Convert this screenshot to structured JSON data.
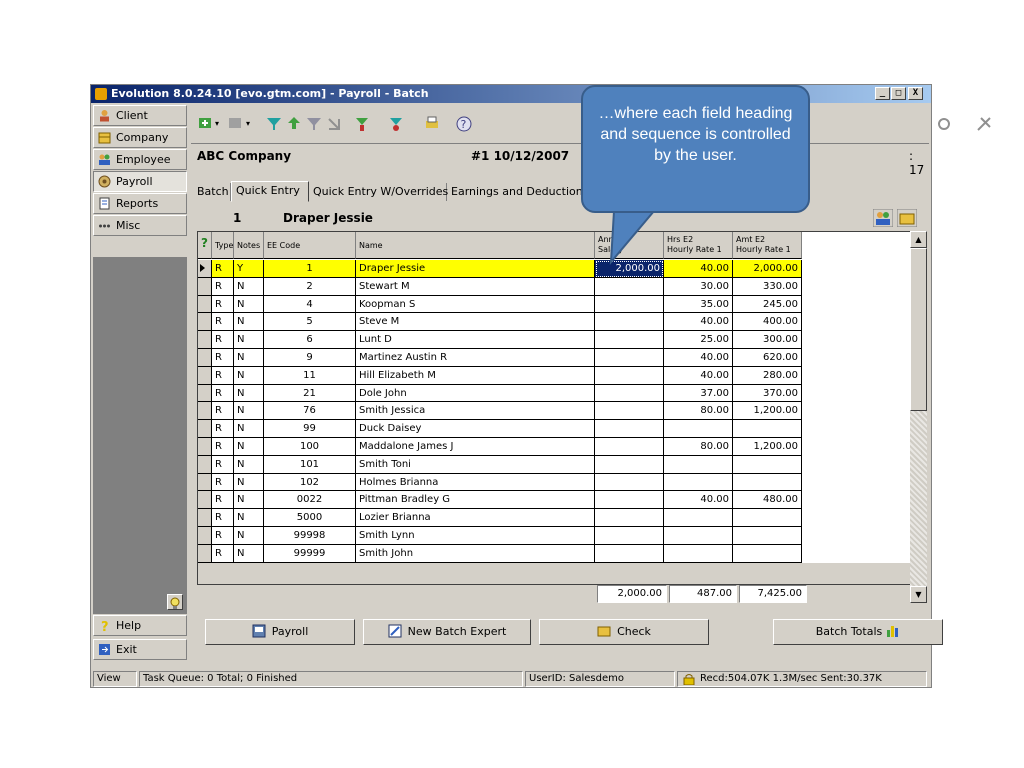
{
  "window": {
    "title": "Evolution 8.0.24.10 [evo.gtm.com] - Payroll - Batch",
    "controls": [
      "_",
      "□",
      "X"
    ]
  },
  "sidebar": {
    "items": [
      {
        "label": "Client",
        "icon": "person-icon"
      },
      {
        "label": "Company",
        "icon": "building-icon"
      },
      {
        "label": "Employee",
        "icon": "people-icon"
      },
      {
        "label": "Payroll",
        "icon": "payroll-icon",
        "active": true
      },
      {
        "label": "Reports",
        "icon": "report-icon"
      },
      {
        "label": "Misc",
        "icon": "dots-icon"
      }
    ],
    "help": "Help",
    "exit": "Exit"
  },
  "header": {
    "company": "ABC Company",
    "batch": "#1 10/12/2007",
    "right_value": ": 17"
  },
  "tabs": [
    "Batch",
    "Quick Entry",
    "Quick Entry W/Overrides",
    "Earnings and Deductions"
  ],
  "active_tab": "Quick Entry",
  "current_employee": {
    "code": "1",
    "name": "Draper Jessie"
  },
  "grid": {
    "columns": [
      "Type",
      "Notes",
      "EE Code",
      "Name",
      "Annual Salary",
      "Hrs E2 Hourly Rate 1",
      "Amt E2 Hourly Rate 1"
    ],
    "col_header_lines": [
      [
        "Type"
      ],
      [
        "Notes"
      ],
      [
        "EE Code"
      ],
      [
        "Name"
      ],
      [
        "Annual",
        "Salary"
      ],
      [
        "Hrs E2",
        "Hourly Rate 1"
      ],
      [
        "Amt E2",
        "Hourly Rate 1"
      ]
    ],
    "rows": [
      [
        "R",
        "Y",
        "1",
        "Draper Jessie",
        "2,000.00",
        "40.00",
        "2,000.00"
      ],
      [
        "R",
        "N",
        "2",
        "Stewart M",
        "",
        "30.00",
        "330.00"
      ],
      [
        "R",
        "N",
        "4",
        "Koopman S",
        "",
        "35.00",
        "245.00"
      ],
      [
        "R",
        "N",
        "5",
        "Steve M",
        "",
        "40.00",
        "400.00"
      ],
      [
        "R",
        "N",
        "6",
        "Lunt D",
        "",
        "25.00",
        "300.00"
      ],
      [
        "R",
        "N",
        "9",
        "Martinez Austin R",
        "",
        "40.00",
        "620.00"
      ],
      [
        "R",
        "N",
        "11",
        "Hill Elizabeth M",
        "",
        "40.00",
        "280.00"
      ],
      [
        "R",
        "N",
        "21",
        "Dole John",
        "",
        "37.00",
        "370.00"
      ],
      [
        "R",
        "N",
        "76",
        "Smith Jessica",
        "",
        "80.00",
        "1,200.00"
      ],
      [
        "R",
        "N",
        "99",
        "Duck Daisey",
        "",
        "",
        ""
      ],
      [
        "R",
        "N",
        "100",
        "Maddalone James J",
        "",
        "80.00",
        "1,200.00"
      ],
      [
        "R",
        "N",
        "101",
        "Smith Toni",
        "",
        "",
        ""
      ],
      [
        "R",
        "N",
        "102",
        "Holmes Brianna",
        "",
        "",
        ""
      ],
      [
        "R",
        "N",
        "0022",
        "Pittman Bradley G",
        "",
        "40.00",
        "480.00"
      ],
      [
        "R",
        "N",
        "5000",
        "Lozier Brianna",
        "",
        "",
        ""
      ],
      [
        "R",
        "N",
        "99998",
        "Smith Lynn",
        "",
        "",
        ""
      ],
      [
        "R",
        "N",
        "99999",
        "Smith John",
        "",
        "",
        ""
      ]
    ],
    "selected_row": 0,
    "totals": [
      "2,000.00",
      "487.00",
      "7,425.00"
    ]
  },
  "buttons": {
    "payroll": "Payroll",
    "new_batch_expert": "New Batch Expert",
    "check": "Check",
    "batch_totals": "Batch Totals"
  },
  "statusbar": {
    "view": "View",
    "task_queue": "Task Queue: 0 Total; 0 Finished",
    "user": "UserID: Salesdemo",
    "transfer": "Recd:504.07K  1.3M/sec  Sent:30.37K"
  },
  "callout": {
    "text": "…where each field heading and sequence is controlled by the user."
  },
  "colors": {
    "title_start": "#0a246a",
    "title_end": "#a6caf0",
    "selected_row": "#ffff00",
    "callout_fill": "#4f81bd",
    "callout_border": "#385d8a"
  }
}
